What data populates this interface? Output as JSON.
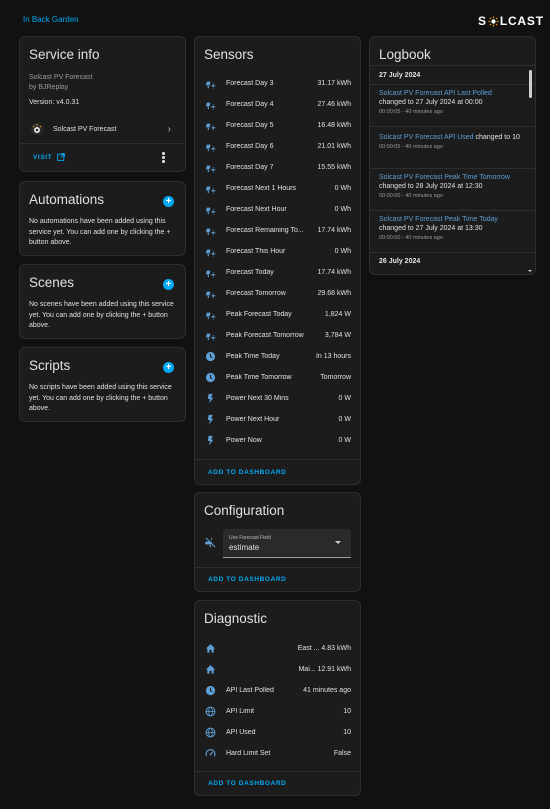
{
  "breadcrumb": "In Back Garden",
  "logo_text": [
    "S",
    "L",
    "CAST"
  ],
  "accent": "#03a9f4",
  "icon_color": "#5e9fd6",
  "service_info": {
    "title": "Service info",
    "name": "Solcast PV Forecast",
    "by": "by BJReplay",
    "version": "Version: v4.0.31",
    "integration": "Solcast PV Forecast",
    "visit": "VISIT"
  },
  "automations": {
    "title": "Automations",
    "text": "No automations have been added using this service yet. You can add one by clicking the + button above."
  },
  "scenes": {
    "title": "Scenes",
    "text": "No scenes have been added using this service yet. You can add one by clicking the + button above."
  },
  "scripts": {
    "title": "Scripts",
    "text": "No scripts have been added using this service yet. You can add one by clicking the + button above."
  },
  "sensors": {
    "title": "Sensors",
    "add": "ADD TO DASHBOARD",
    "rows": [
      {
        "icon": "solar-power-icon",
        "label": "Forecast Day 3",
        "value": "31.17 kWh"
      },
      {
        "icon": "solar-power-icon",
        "label": "Forecast Day 4",
        "value": "27.46 kWh"
      },
      {
        "icon": "solar-power-icon",
        "label": "Forecast Day 5",
        "value": "16.48 kWh"
      },
      {
        "icon": "solar-power-icon",
        "label": "Forecast Day 6",
        "value": "21.01 kWh"
      },
      {
        "icon": "solar-power-icon",
        "label": "Forecast Day 7",
        "value": "15.55 kWh"
      },
      {
        "icon": "solar-power-icon",
        "label": "Forecast Next 1 Hours",
        "value": "0 Wh"
      },
      {
        "icon": "solar-power-icon",
        "label": "Forecast Next Hour",
        "value": "0 Wh"
      },
      {
        "icon": "solar-power-icon",
        "label": "Forecast Remaining To...",
        "value": "17.74 kWh"
      },
      {
        "icon": "solar-power-icon",
        "label": "Forecast This Hour",
        "value": "0 Wh"
      },
      {
        "icon": "solar-power-icon",
        "label": "Forecast Today",
        "value": "17.74 kWh"
      },
      {
        "icon": "solar-power-icon",
        "label": "Forecast Tomorrow",
        "value": "29.68 kWh"
      },
      {
        "icon": "solar-power-icon",
        "label": "Peak Forecast Today",
        "value": "1,824 W"
      },
      {
        "icon": "solar-power-icon",
        "label": "Peak Forecast Tomorrow",
        "value": "3,784 W"
      },
      {
        "icon": "clock-icon",
        "label": "Peak Time Today",
        "value": "In 13 hours"
      },
      {
        "icon": "clock-icon",
        "label": "Peak Time Tomorrow",
        "value": "Tomorrow"
      },
      {
        "icon": "flash-icon",
        "label": "Power Next 30 Mins",
        "value": "0 W"
      },
      {
        "icon": "flash-icon",
        "label": "Power Next Hour",
        "value": "0 W"
      },
      {
        "icon": "flash-icon",
        "label": "Power Now",
        "value": "0 W"
      }
    ]
  },
  "configuration": {
    "title": "Configuration",
    "field_label": "Use Forecast Field",
    "field_value": "estimate",
    "add": "ADD TO DASHBOARD"
  },
  "diagnostic": {
    "title": "Diagnostic",
    "add": "ADD TO DASHBOARD",
    "rows": [
      {
        "icon": "home-icon",
        "label": "",
        "value": "East ...  4.83 kWh"
      },
      {
        "icon": "home-icon",
        "label": "",
        "value": "Mai...  12.91 kWh"
      },
      {
        "icon": "clock-icon",
        "label": "API Last Polled",
        "value": "41 minutes ago"
      },
      {
        "icon": "web-icon",
        "label": "API Limit",
        "value": "10"
      },
      {
        "icon": "web-icon",
        "label": "API Used",
        "value": "10"
      },
      {
        "icon": "gauge-icon",
        "label": "Hard Limit Set",
        "value": "False"
      }
    ]
  },
  "logbook": {
    "title": "Logbook",
    "date1": "27 July 2024",
    "date2": "26 July 2024",
    "entries": [
      {
        "link": "Solcast PV Forecast API Last Polled",
        "text": "changed to 27 July 2024 at 00:00",
        "time": "00:00:05 - 40 minutes ago"
      },
      {
        "link": "Solcast PV Forecast API Used",
        "text": "changed to 10",
        "time": "00:00:05 - 40 minutes ago"
      },
      {
        "link": "Solcast PV Forecast Peak Time Tomorrow",
        "text": "changed to 28 July 2024 at 12:30",
        "time": "00:00:00 - 40 minutes ago"
      },
      {
        "link": "Solcast PV Forecast Peak Time Today",
        "text": "changed to 27 July 2024 at 13:30",
        "time": "00:00:00 - 40 minutes ago"
      }
    ]
  }
}
